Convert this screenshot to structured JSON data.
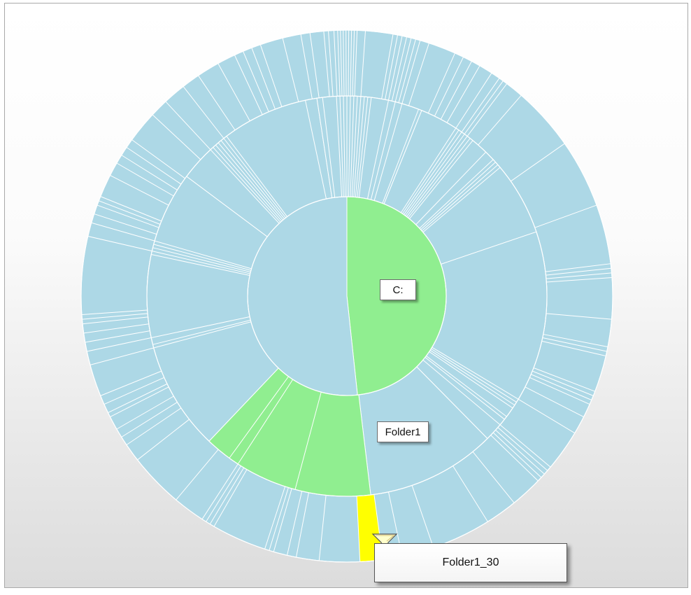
{
  "chart_data": {
    "type": "sunburst",
    "title": "",
    "colors": {
      "default": "#add8e6",
      "selected_path": "#90ee90",
      "hovered": "#ffff00",
      "separator": "#ffffff"
    },
    "rings": [
      {
        "level": 1,
        "segments": [
          {
            "label": "C:",
            "fraction": 0.483,
            "selected": true
          },
          {
            "label": "",
            "fraction": 0.517
          }
        ]
      },
      {
        "level": 2,
        "segments": [
          {
            "label": "",
            "fraction": 0.061
          },
          {
            "label": "",
            "fraction": 0.137
          },
          {
            "label": "",
            "fraction": 0.178
          },
          {
            "label": "",
            "fraction": 0.105
          },
          {
            "label": "Folder1",
            "fraction": 0.14,
            "selected": true
          },
          {
            "label": "",
            "fraction": 0.231
          },
          {
            "label": "",
            "fraction": 0.124
          },
          {
            "label": "",
            "fraction": 0.024
          }
        ]
      },
      {
        "level": 3,
        "segments": [
          {
            "label": "Folder1_30",
            "fraction": 0.014,
            "hovered": true
          }
        ]
      }
    ]
  },
  "labels": {
    "root": "C:",
    "level2": "Folder1"
  },
  "tooltip": {
    "text": "Folder1_30"
  },
  "cursor": {
    "icon": "magnifier-cursor-icon"
  }
}
